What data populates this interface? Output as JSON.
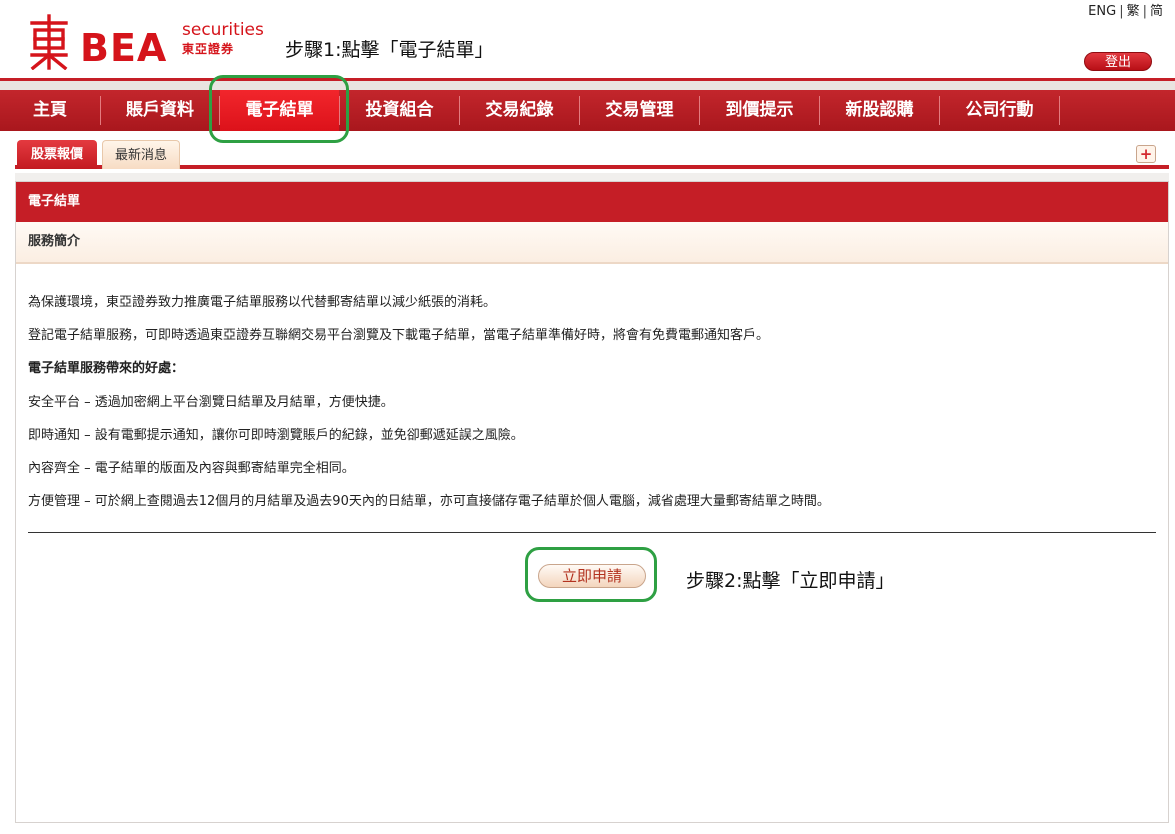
{
  "header": {
    "logo": {
      "brand": "BEA",
      "sub_en": "securities",
      "sub_cn": "東亞證券"
    },
    "step1_text": "步驟1:點擊「電子結單」",
    "lang": {
      "eng": "ENG",
      "trad": "繁",
      "simp": "简"
    },
    "logout_label": "登出"
  },
  "nav": {
    "items": [
      {
        "label": "主頁"
      },
      {
        "label": "賬戶資料"
      },
      {
        "label": "電子結單",
        "active": true
      },
      {
        "label": "投資組合"
      },
      {
        "label": "交易紀錄"
      },
      {
        "label": "交易管理"
      },
      {
        "label": "到價提示"
      },
      {
        "label": "新股認購"
      },
      {
        "label": "公司行動"
      }
    ]
  },
  "subtabs": {
    "items": [
      {
        "label": "股票報價",
        "active": true
      },
      {
        "label": "最新消息"
      }
    ],
    "plus_label": "+"
  },
  "panel": {
    "title": "電子結單",
    "subtitle": "服務簡介",
    "paragraphs": [
      "為保護環境，東亞證券致力推廣電子結單服務以代替郵寄結單以減少紙張的消耗。",
      "登記電子結單服務，可即時透過東亞證券互聯網交易平台瀏覽及下載電子結單，當電子結單準備好時，將會有免費電郵通知客戶。",
      "電子結單服務帶來的好處：",
      "安全平台 – 透過加密網上平台瀏覽日結單及月結單，方便快捷。",
      "即時通知 – 設有電郵提示通知，讓你可即時瀏覽賬戶的紀錄，並免卻郵遞延誤之風險。",
      "內容齊全 – 電子結單的版面及內容與郵寄結單完全相同。",
      "方便管理 – 可於網上查閱過去12個月的月結單及過去90天內的日結單，亦可直接儲存電子結單於個人電腦，減省處理大量郵寄結單之時間。"
    ],
    "apply_label": "立即申請",
    "step2_text": "步驟2:點擊「立即申請」"
  },
  "colors": {
    "brand_red": "#c51e26",
    "active_red": "#e8161e",
    "highlight_green": "#2ea043"
  }
}
